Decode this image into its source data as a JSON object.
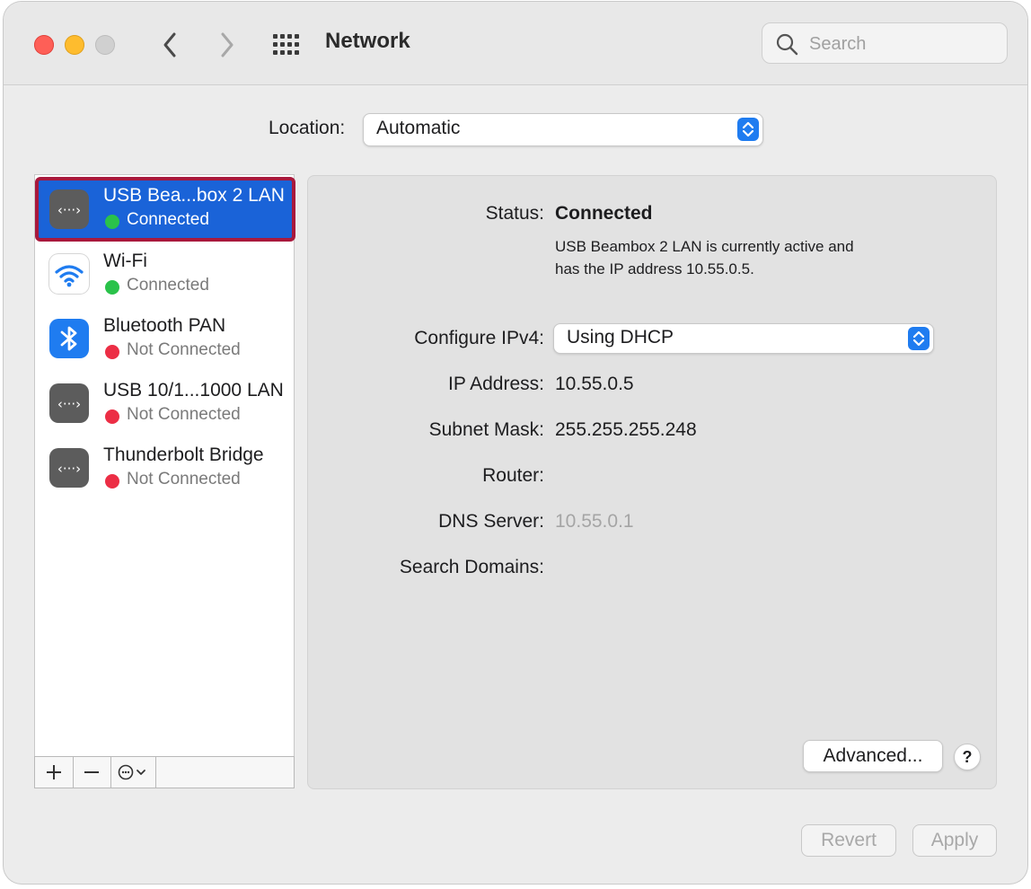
{
  "window": {
    "title": "Network"
  },
  "toolbar": {
    "search_placeholder": "Search"
  },
  "location": {
    "label": "Location:",
    "value": "Automatic"
  },
  "services": [
    {
      "name": "USB Bea...box 2 LAN",
      "status": "Connected",
      "icon": "ethernet-icon",
      "status_color": "#2ac24a",
      "selected": true
    },
    {
      "name": "Wi-Fi",
      "status": "Connected",
      "icon": "wifi-icon",
      "status_color": "#2ac24a"
    },
    {
      "name": "Bluetooth PAN",
      "status": "Not Connected",
      "icon": "bluetooth-icon",
      "status_color": "#ec2e45"
    },
    {
      "name": "USB 10/1...1000 LAN",
      "status": "Not Connected",
      "icon": "ethernet-icon",
      "status_color": "#ec2e45"
    },
    {
      "name": "Thunderbolt Bridge",
      "status": "Not Connected",
      "icon": "ethernet-icon",
      "status_color": "#ec2e45"
    }
  ],
  "detail": {
    "status_label": "Status:",
    "status_value": "Connected",
    "status_desc_1": "USB Beambox 2 LAN is currently active and",
    "status_desc_2": "has the IP address 10.55.0.5.",
    "ipv4_label": "Configure IPv4:",
    "ipv4_value": "Using DHCP",
    "ip_label": "IP Address:",
    "ip_value": "10.55.0.5",
    "subnet_label": "Subnet Mask:",
    "subnet_value": "255.255.255.248",
    "router_label": "Router:",
    "router_value": "",
    "dns_label": "DNS Server:",
    "dns_value": "10.55.0.1",
    "search_domains_label": "Search Domains:",
    "search_domains_value": ""
  },
  "buttons": {
    "advanced": "Advanced...",
    "help": "?",
    "revert": "Revert",
    "apply": "Apply"
  },
  "colors": {
    "selection": "#1a63d8",
    "selection_outline": "#a8193d",
    "accent": "#1f7cf0"
  }
}
